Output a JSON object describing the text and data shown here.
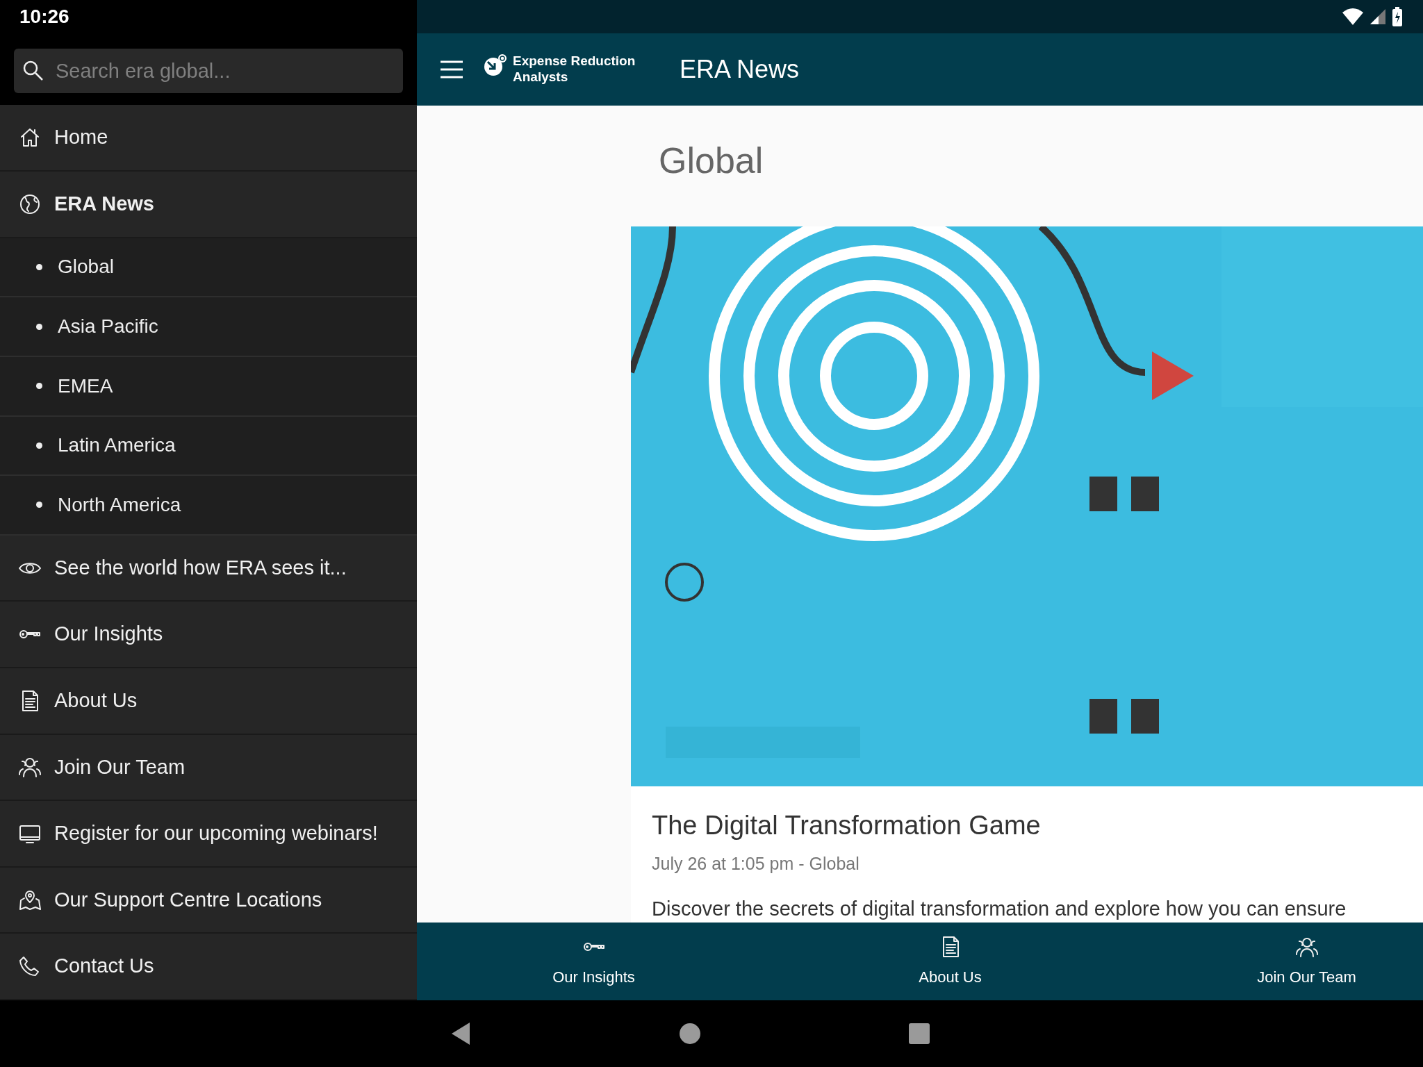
{
  "status_bar": {
    "time": "10:26"
  },
  "drawer": {
    "search": {
      "placeholder": "Search era global..."
    },
    "items": [
      {
        "label": "Home",
        "selected": false
      },
      {
        "label": "ERA News",
        "selected": true,
        "children": [
          {
            "label": "Global"
          },
          {
            "label": "Asia Pacific"
          },
          {
            "label": "EMEA"
          },
          {
            "label": "Latin America"
          },
          {
            "label": "North America"
          }
        ]
      },
      {
        "label": "See the world how ERA sees it...",
        "selected": false
      },
      {
        "label": "Our Insights",
        "selected": false
      },
      {
        "label": "About Us",
        "selected": false
      },
      {
        "label": "Join Our Team",
        "selected": false
      },
      {
        "label": "Register for our upcoming webinars!",
        "selected": false
      },
      {
        "label": "Our Support Centre Locations",
        "selected": false
      },
      {
        "label": "Contact Us",
        "selected": false
      }
    ]
  },
  "app_bar": {
    "logo_text": "Expense Reduction Analysts",
    "title": "ERA News"
  },
  "page": {
    "heading": "Global",
    "article": {
      "title": "The Digital Transformation Game",
      "meta": "July 26 at 1:05 pm - Global",
      "excerpt": "Discover the secrets of digital transformation and explore how you can ensure"
    }
  },
  "bottom_nav": [
    {
      "label": "Our Insights"
    },
    {
      "label": "About Us"
    },
    {
      "label": "Join Our Team"
    }
  ]
}
